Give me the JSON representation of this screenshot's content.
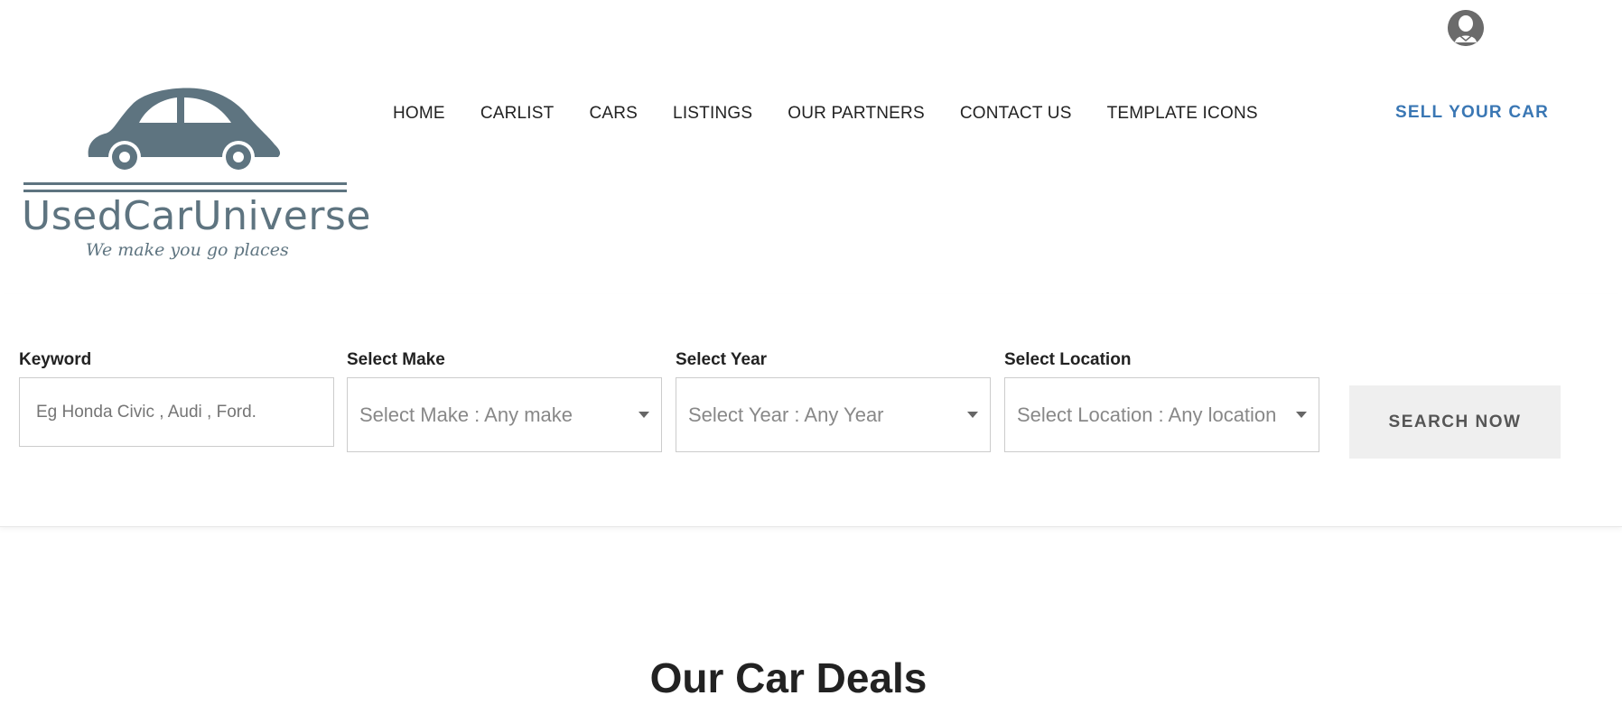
{
  "header": {
    "user_icon": "user-profile-icon",
    "logo": {
      "brand": "UsedCarUniverse",
      "tagline": "We make you go places",
      "color": "#5e7480"
    },
    "nav": [
      "HOME",
      "CARLIST",
      "CARS",
      "LISTINGS",
      "OUR PARTNERS",
      "CONTACT US",
      "TEMPLATE ICONS"
    ],
    "sell_label": "SELL YOUR CAR",
    "accent_color": "#3a77b4"
  },
  "search": {
    "keyword": {
      "label": "Keyword",
      "placeholder": "Eg Honda Civic , Audi , Ford."
    },
    "make": {
      "label": "Select Make",
      "value": "Select Make : Any make"
    },
    "year": {
      "label": "Select Year",
      "value": "Select Year : Any Year"
    },
    "location": {
      "label": "Select Location",
      "value": "Select Location : Any location"
    },
    "button_label": "SEARCH NOW"
  },
  "main": {
    "section_title": "Our Car Deals"
  }
}
